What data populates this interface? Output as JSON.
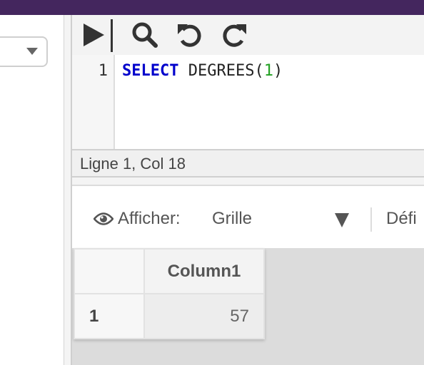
{
  "colors": {
    "topbar": "#44265e",
    "keyword": "#0000cc",
    "number": "#22a022"
  },
  "sidebar": {
    "dropdown": {
      "value": "",
      "icon": "chevron-down-icon"
    }
  },
  "toolbar": {
    "buttons": [
      {
        "name": "run",
        "icon": "play-icon"
      },
      {
        "name": "search",
        "icon": "search-icon"
      },
      {
        "name": "undo",
        "icon": "undo-icon"
      },
      {
        "name": "redo",
        "icon": "redo-icon"
      }
    ]
  },
  "editor": {
    "line_number": "1",
    "code": {
      "keyword": "SELECT",
      "func": " DEGREES(",
      "arg": "1",
      "close": ")"
    }
  },
  "status": {
    "position": "Ligne 1, Col 18"
  },
  "results": {
    "view_label": "Afficher:",
    "view_value": "Grille",
    "define_label": "Défi",
    "columns": [
      "Column1"
    ],
    "rows": [
      {
        "index": "1",
        "values": [
          "57"
        ]
      }
    ]
  }
}
